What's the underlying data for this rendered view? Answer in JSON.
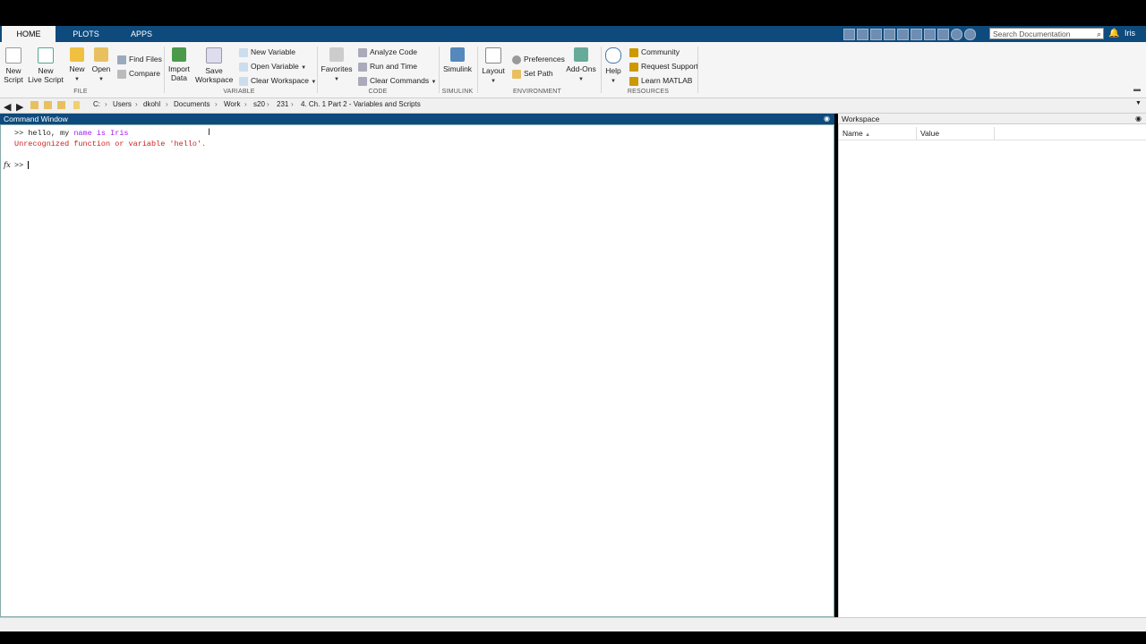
{
  "tabs": [
    "HOME",
    "PLOTS",
    "APPS"
  ],
  "search": {
    "placeholder": "Search Documentation"
  },
  "user": "Iris",
  "ribbon": {
    "file": {
      "new_script": "New\nScript",
      "new_live_script": "New\nLive Script",
      "new": "New",
      "open": "Open",
      "find_files": "Find Files",
      "compare": "Compare",
      "group": "FILE"
    },
    "variable": {
      "import_data": "Import\nData",
      "save_workspace": "Save\nWorkspace",
      "new_variable": "New Variable",
      "open_variable": "Open Variable",
      "clear_workspace": "Clear Workspace",
      "group": "VARIABLE"
    },
    "code": {
      "favorites": "Favorites",
      "analyze_code": "Analyze Code",
      "run_and_time": "Run and Time",
      "clear_commands": "Clear Commands",
      "group": "CODE"
    },
    "simulink": {
      "simulink": "Simulink",
      "group": "SIMULINK"
    },
    "environment": {
      "layout": "Layout",
      "preferences": "Preferences",
      "set_path": "Set Path",
      "add_ons": "Add-Ons",
      "group": "ENVIRONMENT"
    },
    "resources": {
      "help": "Help",
      "community": "Community",
      "request_support": "Request Support",
      "learn_matlab": "Learn MATLAB",
      "group": "RESOURCES"
    }
  },
  "path": [
    "C:",
    "Users",
    "dkohl",
    "Documents",
    "Work",
    "s20",
    "231",
    "4. Ch. 1 Part 2 - Variables and Scripts"
  ],
  "command_window": {
    "title": "Command Window",
    "line1_prompt": ">> ",
    "line1_code": "hello, my ",
    "line1_str": "name is Iris",
    "line2_error": "Unrecognized function or variable 'hello'.",
    "fx": "fx",
    "prompt": ">> "
  },
  "workspace": {
    "title": "Workspace",
    "columns": [
      "Name",
      "Value"
    ],
    "sort_indicator": "▲"
  },
  "colors": {
    "titlebar": "#0e4a7c",
    "error": "#cc2222",
    "string": "#a020f0"
  }
}
